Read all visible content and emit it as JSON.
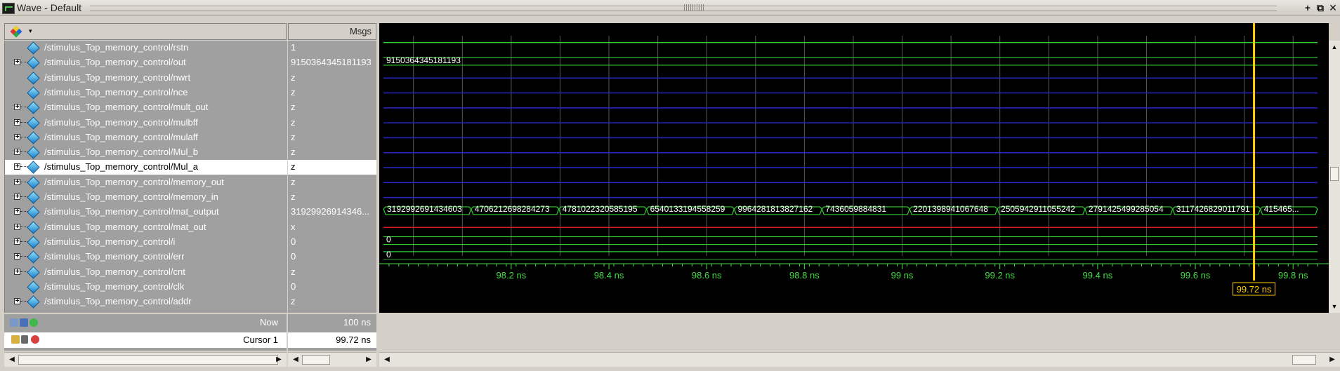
{
  "window": {
    "title": "Wave - Default",
    "dock_glyph": "+",
    "undock_glyph": "⧉",
    "close_glyph": "✕"
  },
  "header": {
    "values_column": "Msgs",
    "palette_dropdown_glyph": "▾"
  },
  "signals": [
    {
      "name": "/stimulus_Top_memory_control/rstn",
      "value": "1",
      "expandable": false
    },
    {
      "name": "/stimulus_Top_memory_control/out",
      "value": "9150364345181193",
      "expandable": true
    },
    {
      "name": "/stimulus_Top_memory_control/nwrt",
      "value": "z",
      "expandable": false
    },
    {
      "name": "/stimulus_Top_memory_control/nce",
      "value": "z",
      "expandable": false
    },
    {
      "name": "/stimulus_Top_memory_control/mult_out",
      "value": "z",
      "expandable": true
    },
    {
      "name": "/stimulus_Top_memory_control/mulbff",
      "value": "z",
      "expandable": true
    },
    {
      "name": "/stimulus_Top_memory_control/mulaff",
      "value": "z",
      "expandable": true
    },
    {
      "name": "/stimulus_Top_memory_control/Mul_b",
      "value": "z",
      "expandable": true
    },
    {
      "name": "/stimulus_Top_memory_control/Mul_a",
      "value": "z",
      "expandable": true,
      "selected": true
    },
    {
      "name": "/stimulus_Top_memory_control/memory_out",
      "value": "z",
      "expandable": true
    },
    {
      "name": "/stimulus_Top_memory_control/memory_in",
      "value": "z",
      "expandable": true
    },
    {
      "name": "/stimulus_Top_memory_control/mat_output",
      "value": "31929926914346...",
      "expandable": true
    },
    {
      "name": "/stimulus_Top_memory_control/mat_out",
      "value": "x",
      "expandable": true
    },
    {
      "name": "/stimulus_Top_memory_control/i",
      "value": "0",
      "expandable": true
    },
    {
      "name": "/stimulus_Top_memory_control/err",
      "value": "0",
      "expandable": true
    },
    {
      "name": "/stimulus_Top_memory_control/cnt",
      "value": "z",
      "expandable": true
    },
    {
      "name": "/stimulus_Top_memory_control/clk",
      "value": "0",
      "expandable": false
    },
    {
      "name": "/stimulus_Top_memory_control/addr",
      "value": "z",
      "expandable": true
    }
  ],
  "waves": {
    "out_label": "9150364345181193",
    "mat_output_values": [
      "3192992691434603",
      "4706212698284273",
      "4781022320585195",
      "6540133194558259",
      "9964281813827162",
      "7436059884831",
      "2201398941067648",
      "2505942911055242",
      "2791425499285054",
      "3117426829011791",
      "415465..."
    ],
    "i_label": "0",
    "err_label": "0"
  },
  "timeline": {
    "start_ns": 97.93,
    "end_ns": 99.85,
    "ticks": [
      {
        "ns": 98.2,
        "label": "98.2 ns"
      },
      {
        "ns": 98.4,
        "label": "98.4 ns"
      },
      {
        "ns": 98.6,
        "label": "98.6 ns"
      },
      {
        "ns": 98.8,
        "label": "98.8 ns"
      },
      {
        "ns": 99.0,
        "label": "99 ns"
      },
      {
        "ns": 99.2,
        "label": "99.2 ns"
      },
      {
        "ns": 99.4,
        "label": "99.4 ns"
      },
      {
        "ns": 99.6,
        "label": "99.6 ns"
      },
      {
        "ns": 99.8,
        "label": "99.8 ns"
      }
    ],
    "cursor_ns": 99.72,
    "cursor_label": "99.72 ns"
  },
  "footer": {
    "now_label": "Now",
    "now_value": "100 ns",
    "cursor_label": "Cursor 1",
    "cursor_value": "99.72 ns"
  },
  "colors": {
    "wave_green": "#33cc33",
    "wave_blue": "#2828c8",
    "wave_red": "#d02020",
    "grid": "#5a5a5a",
    "cursor": "#ffcc00",
    "tick_text": "#44dd44"
  }
}
